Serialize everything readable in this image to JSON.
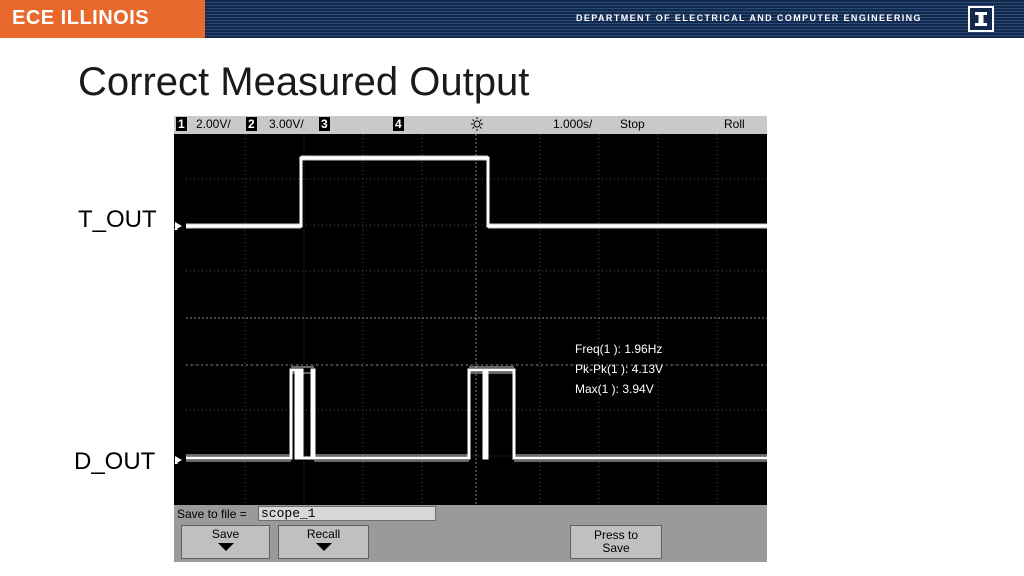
{
  "header": {
    "logo": "ECE ILLINOIS",
    "department": "DEPARTMENT OF ELECTRICAL AND COMPUTER ENGINEERING"
  },
  "slide": {
    "title": "Correct Measured Output",
    "label_top": "T_OUT",
    "label_bottom": "D_OUT"
  },
  "scope": {
    "status": {
      "ch1_num": "1",
      "ch1_scale": "2.00V/",
      "ch2_num": "2",
      "ch2_scale": "3.00V/",
      "ch3_num": "3",
      "ch4_num": "4",
      "timebase": "1.000s/",
      "run_state": "Stop",
      "mode": "Roll"
    },
    "measurements": [
      "Freq(1 ): 1.96Hz",
      "Pk-Pk(1 ): 4.13V",
      "Max(1 ): 3.94V"
    ],
    "ground_markers": {
      "ch2": "2",
      "ch1": "1"
    },
    "save_to_file_label": "Save to file =",
    "filename": "scope_1",
    "buttons": {
      "save": "Save",
      "recall": "Recall",
      "press_line1": "Press to",
      "press_line2": "Save"
    }
  },
  "colors": {
    "header_navy": "#13294b",
    "logo_orange": "#e8692b",
    "trace": "#ffffff",
    "grid": "#5a5a5a"
  }
}
